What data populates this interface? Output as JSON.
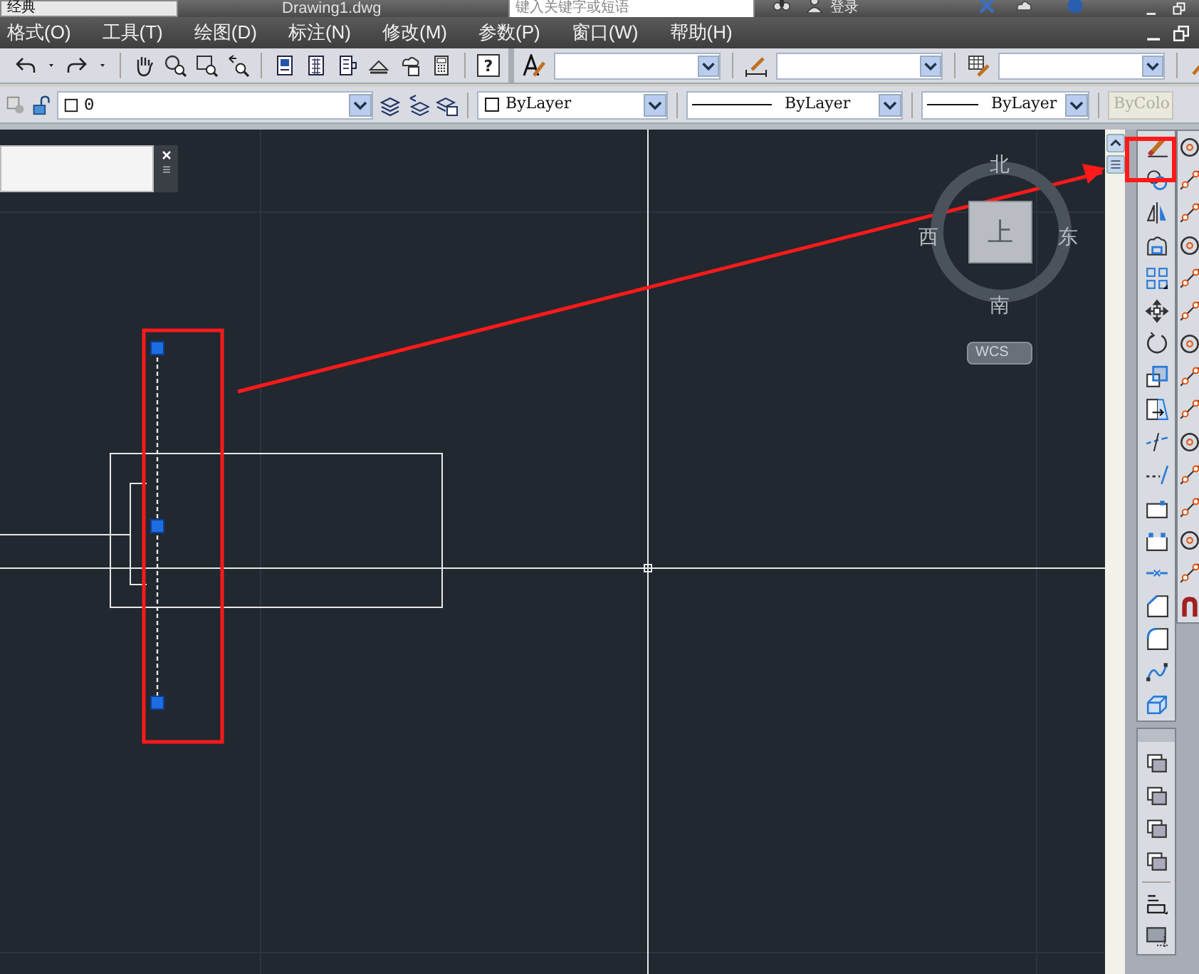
{
  "title_bar": {
    "workspace": "经典",
    "file_title": "Drawing1.dwg",
    "search": {
      "placeholder": "键入关键字或短语"
    },
    "sign_in": "登录"
  },
  "menu_bar": [
    "格式(O)",
    "工具(T)",
    "绘图(D)",
    "标注(N)",
    "修改(M)",
    "参数(P)",
    "窗口(W)",
    "帮助(H)"
  ],
  "standard_toolbar": {
    "help_button": "?"
  },
  "properties_bar": {
    "layer": "0",
    "color_control": "ByLayer",
    "linetype": "ByLayer",
    "lineweight": "ByLayer",
    "plot_style": {
      "label": "ByColo",
      "disabled": true
    }
  },
  "view_cube": {
    "north": "北",
    "south": "南",
    "east": "东",
    "west": "西",
    "face": "上",
    "coordinate_system": "WCS"
  }
}
